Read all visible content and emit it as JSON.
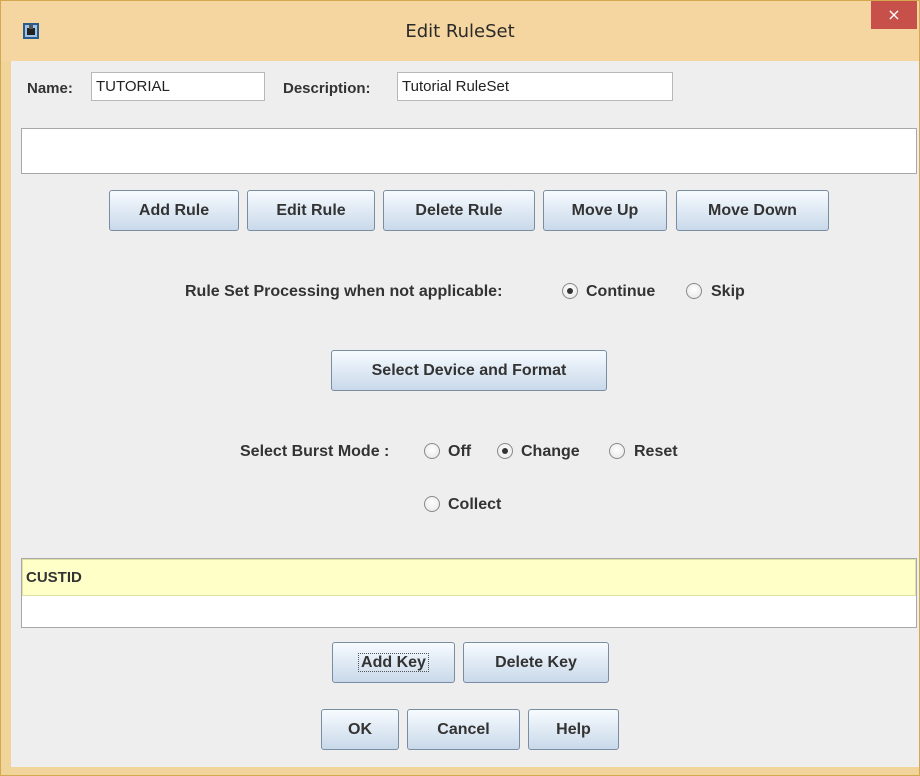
{
  "window": {
    "title": "Edit RuleSet",
    "close_glyph": "×",
    "icon": "app-icon",
    "titlebar_color": "#f5d6a0",
    "close_color": "#c7504a"
  },
  "fields": {
    "name_label": "Name:",
    "name_value": "TUTORIAL",
    "description_label": "Description:",
    "description_value": "Tutorial RuleSet"
  },
  "rule_buttons": {
    "add": "Add Rule",
    "edit": "Edit Rule",
    "delete": "Delete Rule",
    "move_up": "Move Up",
    "move_down": "Move Down"
  },
  "processing": {
    "label": "Rule Set Processing when not applicable:",
    "options": [
      {
        "label": "Continue",
        "checked": true
      },
      {
        "label": "Skip",
        "checked": false
      }
    ]
  },
  "device_button": "Select Device and Format",
  "burst": {
    "label": "Select Burst Mode :",
    "options": [
      {
        "label": "Off",
        "checked": false
      },
      {
        "label": "Change",
        "checked": true
      },
      {
        "label": "Reset",
        "checked": false
      },
      {
        "label": "Collect",
        "checked": false
      }
    ]
  },
  "keys": {
    "rows": [
      "CUSTID"
    ],
    "highlight_color": "#ffffc8",
    "add": "Add Key",
    "delete": "Delete Key"
  },
  "footer": {
    "ok": "OK",
    "cancel": "Cancel",
    "help": "Help"
  }
}
